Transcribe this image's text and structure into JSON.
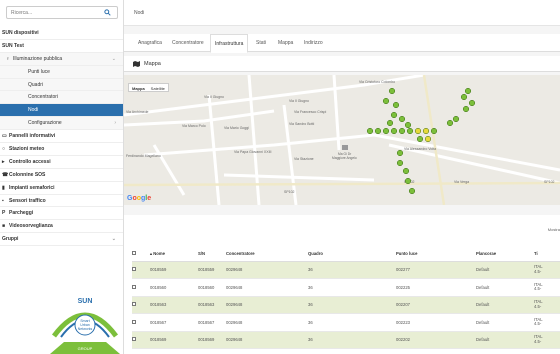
{
  "sidebar": {
    "search_placeholder": "Ricerca...",
    "items": [
      {
        "label": "SUN dispositivi",
        "type": "top"
      },
      {
        "label": "SUN Test",
        "type": "top"
      },
      {
        "label": "Illuminazione pubblica",
        "type": "open",
        "icon": "bulb-icon"
      },
      {
        "label": "Punti luce",
        "type": "sub"
      },
      {
        "label": "Quadri",
        "type": "sub"
      },
      {
        "label": "Concentratori",
        "type": "sub"
      },
      {
        "label": "Nodi",
        "type": "sub-active"
      },
      {
        "label": "Configurazione",
        "type": "sub",
        "chevron": true
      },
      {
        "label": "Pannelli informativi",
        "type": "top",
        "icon": "monitor-icon"
      },
      {
        "label": "Stazioni meteo",
        "type": "top",
        "icon": "clock-icon"
      },
      {
        "label": "Controllo accessi",
        "type": "top",
        "icon": "car-icon"
      },
      {
        "label": "Colonnine SOS",
        "type": "top",
        "icon": "phone-icon"
      },
      {
        "label": "Impianti semaforici",
        "type": "top",
        "icon": "traffic-light-icon"
      },
      {
        "label": "Sensori traffico",
        "type": "top",
        "icon": "sensor-car-icon"
      },
      {
        "label": "Parcheggi",
        "type": "top",
        "icon": "parking-icon"
      },
      {
        "label": "Videosorveglianza",
        "type": "top",
        "icon": "camera-icon"
      },
      {
        "label": "Gruppi",
        "type": "top"
      }
    ],
    "logo": {
      "top": "SUN",
      "line1": "Smart",
      "line2": "Urban",
      "line3": "Networks",
      "bottom": "GROUP"
    }
  },
  "topbar": {
    "breadcrumb": "Nodi"
  },
  "tabs": [
    "Anagrafica",
    "Concentratore",
    "Infrastruttura",
    "Stati",
    "Mappa",
    "Indirizzo"
  ],
  "active_tab": 2,
  "panel": {
    "title": "Mappa"
  },
  "map": {
    "toggle": [
      "Mappa",
      "Satellite"
    ],
    "streets": [
      "Via Cristoforo Colombo",
      "Via Il Giugno",
      "Via Il Giugno",
      "Via Archimede",
      "Via Marco Polo",
      "Via Francesco Crispi",
      "Via Mario Goggi",
      "Via Papa Giovanni XXIII",
      "Ferdinando Magellano",
      "Via Sandro Botti",
      "Via Verga",
      "Via Stazione",
      "Via Alessandro Volta",
      "SP102",
      "SP102",
      "SP102"
    ],
    "poi": "Ma Gi Dr Maggiore Angelo",
    "colors": {
      "green": "#7cbf3b",
      "yellow": "#e6d93a",
      "road": "#ffffff"
    }
  },
  "table": {
    "mostra": "Mostra",
    "headers": [
      "",
      "Nome",
      "S/N",
      "Concentratore",
      "Quadro",
      "Punto luce",
      "Plancorae",
      "Ti"
    ],
    "rows": [
      {
        "nome": "0018559",
        "sn": "0018559",
        "conc": "0029648",
        "quadro": "36",
        "punto": "002277",
        "planc": "Default",
        "tipo": "ITAL",
        "tipo2": "4.5-"
      },
      {
        "nome": "0018560",
        "sn": "0018560",
        "conc": "0029648",
        "quadro": "36",
        "punto": "002225",
        "planc": "Default",
        "tipo": "ITAL",
        "tipo2": "4.5-"
      },
      {
        "nome": "0018563",
        "sn": "0018563",
        "conc": "0029648",
        "quadro": "36",
        "punto": "002207",
        "planc": "Default",
        "tipo": "ITAL",
        "tipo2": "4.5-"
      },
      {
        "nome": "0018567",
        "sn": "0018567",
        "conc": "0029648",
        "quadro": "36",
        "punto": "002223",
        "planc": "Default",
        "tipo": "ITAL",
        "tipo2": "4.5-"
      },
      {
        "nome": "0018569",
        "sn": "0018569",
        "conc": "0029648",
        "quadro": "36",
        "punto": "002202",
        "planc": "Default",
        "tipo": "ITAL",
        "tipo2": "4.5-"
      }
    ]
  }
}
